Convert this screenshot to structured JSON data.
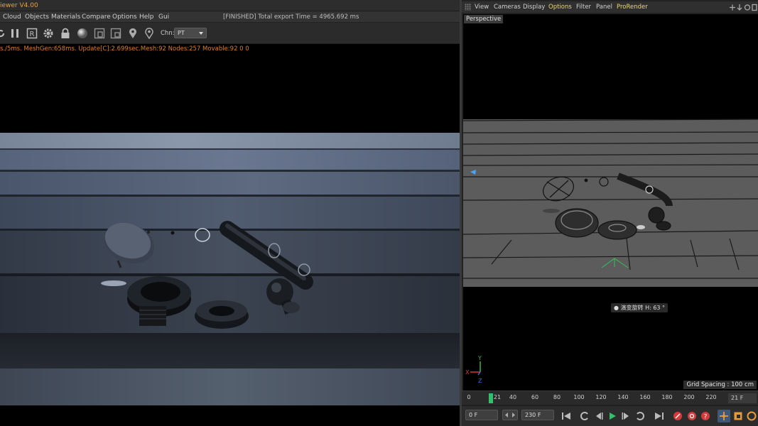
{
  "left_viewer": {
    "title": "iewer V4.00",
    "menu": [
      "Cloud",
      "Objects",
      "Materials",
      "Compare",
      "Options",
      "Help",
      "Gui"
    ],
    "status": "[FINISHED] Total export Time = 4965.692 ms",
    "toolbar": {
      "icons": [
        "refresh-icon",
        "pause-icon",
        "region-render-icon",
        "settings-icon",
        "lock-icon",
        "material-sphere-icon",
        "frame-icon",
        "crop-icon",
        "pin-icon",
        "pin-outline-icon"
      ],
      "channel_label": "Chn:",
      "channel_value": "PT"
    },
    "stats": "s./5ms. MeshGen:658ms. Update[C]:2.699sec.Mesh:92 Nodes:257 Movable:92  0 0"
  },
  "right_viewport": {
    "menu": [
      "View",
      "Cameras",
      "Display",
      "Options",
      "Filter",
      "Panel",
      "ProRender"
    ],
    "menu_active": "Options",
    "menu_highlight": "ProRender",
    "view_label": "Perspective",
    "hud_text": "● 演变旋转 H: 63 °",
    "grid_spacing": "Grid Spacing : 100 cm",
    "axis": {
      "y": "Y",
      "x": "X",
      "z": "Z"
    }
  },
  "timeline": {
    "ticks": [
      "0",
      "21",
      "40",
      "60",
      "80",
      "100",
      "120",
      "140",
      "160",
      "180",
      "200",
      "220"
    ],
    "current_frame": "21 F"
  },
  "transport": {
    "start_field": "0 F",
    "end_field": "230 F",
    "buttons": [
      "go-to-start-icon",
      "previous-key-icon",
      "step-back-icon",
      "play-icon",
      "step-forward-icon",
      "next-key-icon",
      "go-to-end-icon",
      "record-icon",
      "auto-key-icon",
      "keyframe-help-icon",
      "move-keys-icon",
      "scale-keys-icon",
      "param-keys-icon"
    ]
  },
  "colors": {
    "accent_orange": "#e8a23a",
    "active_menu_yellow": "#e8d96a",
    "playhead_green": "#34c06a",
    "record_red": "#d23b3b"
  }
}
